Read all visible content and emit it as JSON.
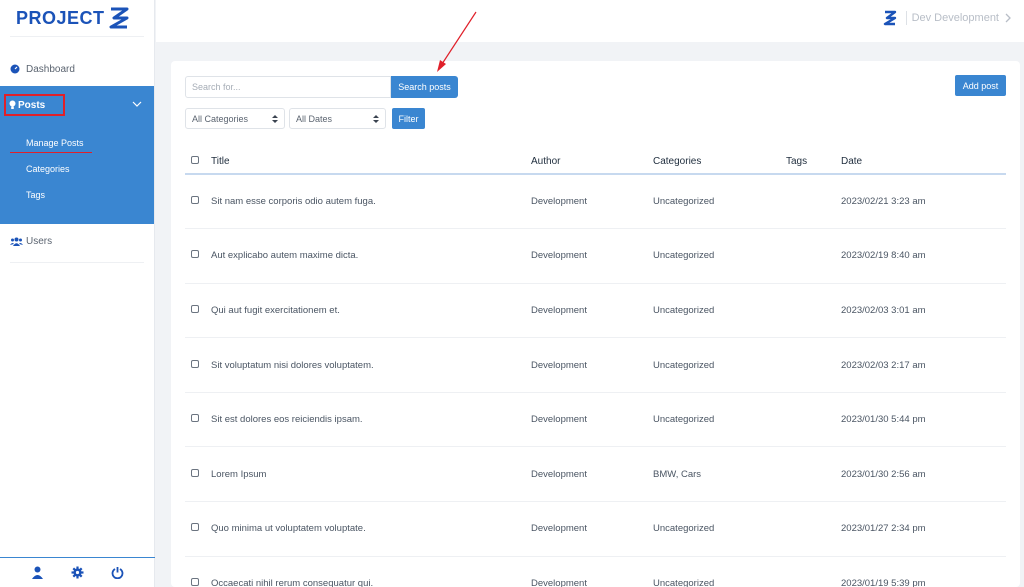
{
  "brand": {
    "logo_text": "PROJECT"
  },
  "topbar": {
    "user_label": "Dev Development"
  },
  "sidebar": {
    "dashboard_label": "Dashboard",
    "posts_label": "Posts",
    "sub_items": [
      "Manage Posts",
      "Categories",
      "Tags"
    ],
    "users_label": "Users"
  },
  "toolbar": {
    "search_placeholder": "Search for...",
    "search_button": "Search posts",
    "add_button": "Add post",
    "category_select": "All Categories",
    "date_select": "All Dates",
    "filter_button": "Filter"
  },
  "table": {
    "headers": [
      "Title",
      "Author",
      "Categories",
      "Tags",
      "Date"
    ],
    "rows": [
      {
        "title": "Sit nam esse corporis odio autem fuga.",
        "author": "Development",
        "categories": "Uncategorized",
        "tags": "",
        "date": "2023/02/21 3:23 am"
      },
      {
        "title": "Aut explicabo autem maxime dicta.",
        "author": "Development",
        "categories": "Uncategorized",
        "tags": "",
        "date": "2023/02/19 8:40 am"
      },
      {
        "title": "Qui aut fugit exercitationem et.",
        "author": "Development",
        "categories": "Uncategorized",
        "tags": "",
        "date": "2023/02/03 3:01 am"
      },
      {
        "title": "Sit voluptatum nisi dolores voluptatem.",
        "author": "Development",
        "categories": "Uncategorized",
        "tags": "",
        "date": "2023/02/03 2:17 am"
      },
      {
        "title": "Sit est dolores eos reiciendis ipsam.",
        "author": "Development",
        "categories": "Uncategorized",
        "tags": "",
        "date": "2023/01/30 5:44 pm"
      },
      {
        "title": "Lorem Ipsum",
        "author": "Development",
        "categories": "BMW, Cars",
        "tags": "",
        "date": "2023/01/30 2:56 am"
      },
      {
        "title": "Quo minima ut voluptatem voluptate.",
        "author": "Development",
        "categories": "Uncategorized",
        "tags": "",
        "date": "2023/01/27 2:34 pm"
      },
      {
        "title": "Occaecati nihil rerum consequatur qui.",
        "author": "Development",
        "categories": "Uncategorized",
        "tags": "",
        "date": "2023/01/19 5:39 pm"
      }
    ]
  },
  "colors": {
    "accent": "#3a86d1",
    "brand": "#1b53b8",
    "annotation": "#e0202a"
  }
}
